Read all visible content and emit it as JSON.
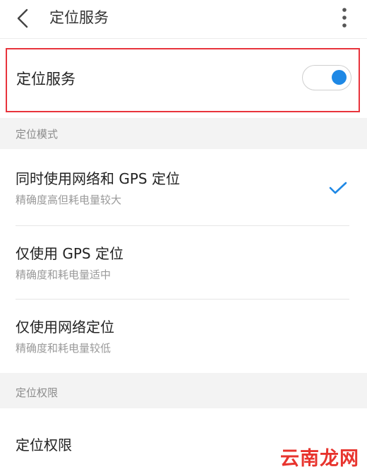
{
  "header": {
    "title": "定位服务",
    "back_icon": "chevron-left-icon",
    "more_icon": "more-vertical-icon"
  },
  "location_service": {
    "label": "定位服务",
    "enabled": true
  },
  "mode_section": {
    "title": "定位模式",
    "options": [
      {
        "title": "同时使用网络和 GPS 定位",
        "subtitle": "精确度高但耗电量较大",
        "selected": true
      },
      {
        "title": "仅使用 GPS 定位",
        "subtitle": "精确度和耗电量适中",
        "selected": false
      },
      {
        "title": "仅使用网络定位",
        "subtitle": "精确度和耗电量较低",
        "selected": false
      }
    ]
  },
  "permission_section": {
    "title": "定位权限",
    "item_label": "定位权限"
  },
  "watermark": {
    "text": "云南龙网"
  },
  "colors": {
    "accent": "#1e88e5",
    "highlight_border": "#e8343c",
    "section_bg": "#f3f3f3",
    "watermark": "#e8342e"
  }
}
